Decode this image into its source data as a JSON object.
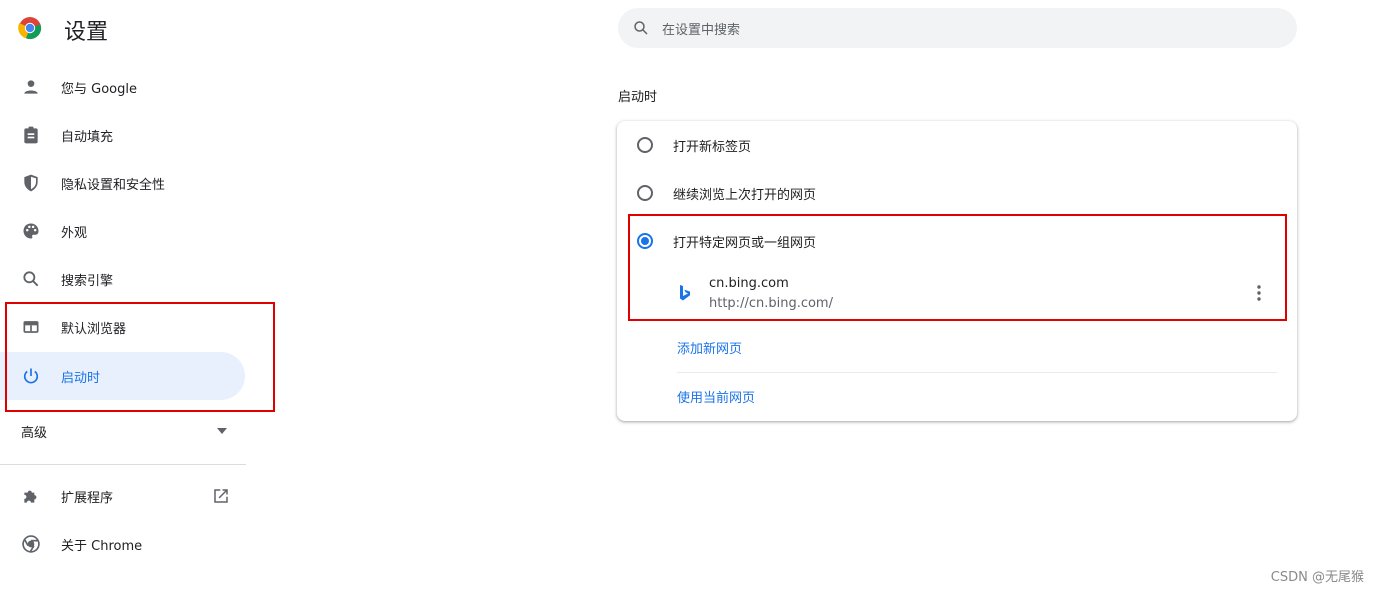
{
  "header": {
    "title": "设置",
    "logo_icon": "chrome-logo-icon"
  },
  "search": {
    "placeholder": "在设置中搜索",
    "icon": "search-icon"
  },
  "sidebar": {
    "items": [
      {
        "label": "您与 Google",
        "icon": "person-icon"
      },
      {
        "label": "自动填充",
        "icon": "clipboard-icon"
      },
      {
        "label": "隐私设置和安全性",
        "icon": "shield-icon"
      },
      {
        "label": "外观",
        "icon": "palette-icon"
      },
      {
        "label": "搜索引擎",
        "icon": "search-icon"
      },
      {
        "label": "默认浏览器",
        "icon": "browser-window-icon"
      },
      {
        "label": "启动时",
        "icon": "power-icon",
        "active": true
      }
    ],
    "advanced_label": "高级",
    "extensions_label": "扩展程序",
    "about_label": "关于 Chrome"
  },
  "startup": {
    "section_title": "启动时",
    "options": [
      {
        "label": "打开新标签页",
        "selected": false
      },
      {
        "label": "继续浏览上次打开的网页",
        "selected": false
      },
      {
        "label": "打开特定网页或一组网页",
        "selected": true
      }
    ],
    "pages": [
      {
        "name": "cn.bing.com",
        "url": "http://cn.bing.com/"
      }
    ],
    "add_page_label": "添加新网页",
    "use_current_label": "使用当前网页"
  },
  "colors": {
    "accent": "#1a73e8",
    "annotation": "#e00000",
    "active_bg": "#e8f0fe"
  },
  "watermark": "CSDN @无尾猴"
}
